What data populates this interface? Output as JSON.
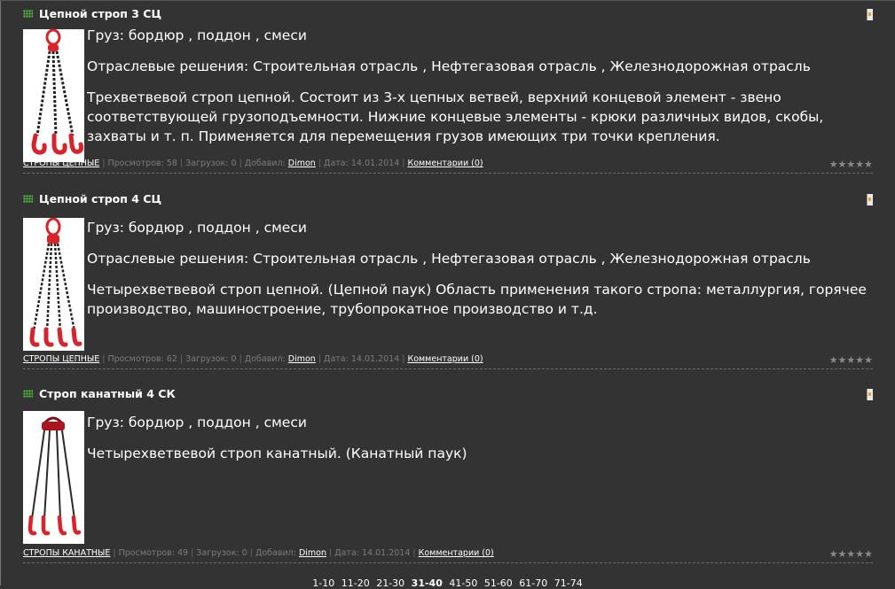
{
  "entries": [
    {
      "title": "Цепной строп 3 СЦ",
      "paragraphs": [
        "Груз: бордюр , поддон , смеси",
        "Отраслевые решения: Строительная отрасль , Нефтегазовая отрасль , Железнодорожная отрасль",
        "Трехветвевой строп цепной. Состоит из 3-х цепных ветвей, верхний концевой элемент - звено соответствующей грузоподъемности. Нижние концевые элементы - крюки различных видов, скобы, захваты и т. п. Применяется  для перемещения грузов имеющих три  точки крепления."
      ],
      "category": "СТРОПЫ ЦЕПНЫЕ",
      "views_label": "Просмотров: 58",
      "downloads_label": "Загрузок: 0",
      "added_label": "Добавил:",
      "author": "Dimon",
      "date_label": "Дата: 14.01.2014",
      "comments": "Комментарии (0)",
      "stars": "★★★★★",
      "image": "three-leg-chain-sling"
    },
    {
      "title": "Цепной строп 4 СЦ",
      "paragraphs": [
        "Груз: бордюр , поддон , смеси",
        "Отраслевые решения: Строительная отрасль , Нефтегазовая отрасль , Железнодорожная отрасль",
        "Четырехветвевой строп цепной. (Цепной паук) Область применения такого стропа: металлургия, горячее производство, машиностроение, трубопрокатное производство и т.д."
      ],
      "category": "СТРОПЫ ЦЕПНЫЕ",
      "views_label": "Просмотров: 62",
      "downloads_label": "Загрузок: 0",
      "added_label": "Добавил:",
      "author": "Dimon",
      "date_label": "Дата: 14.01.2014",
      "comments": "Комментарии (0)",
      "stars": "★★★★★",
      "image": "four-leg-chain-sling"
    },
    {
      "title": "Строп канатный 4 СК",
      "paragraphs": [
        "Груз: бордюр , поддон , смеси",
        "Четырехветвевой строп канатный. (Канатный паук)"
      ],
      "category": "СТРОПЫ КАНАТНЫЕ",
      "views_label": "Просмотров: 49",
      "downloads_label": "Загрузок: 0",
      "added_label": "Добавил:",
      "author": "Dimon",
      "date_label": "Дата: 14.01.2014",
      "comments": "Комментарии (0)",
      "stars": "★★★★★",
      "image": "four-leg-wire-rope-sling"
    }
  ],
  "pager": {
    "pages": [
      "1-10",
      "11-20",
      "21-30",
      "31-40",
      "41-50",
      "51-60",
      "61-70",
      "71-74"
    ],
    "current": "31-40"
  },
  "colors": {
    "background": "#333333",
    "bullet": "#4fc23a",
    "hook_red": "#d8232a"
  }
}
